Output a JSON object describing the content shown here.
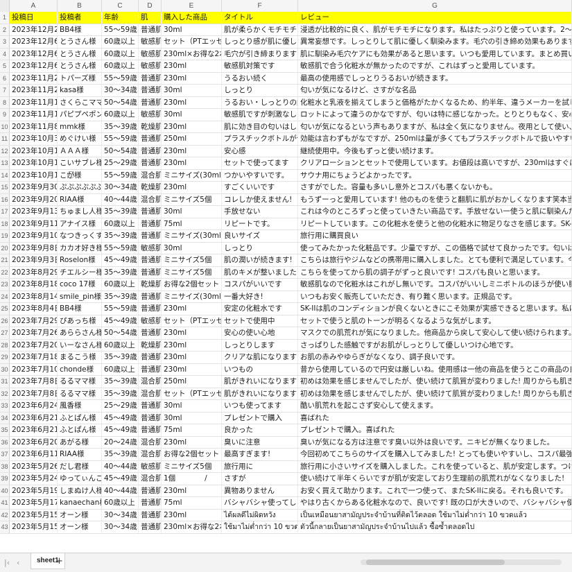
{
  "columns": [
    "A",
    "B",
    "C",
    "D",
    "E",
    "F",
    "G"
  ],
  "header": [
    "投稿日",
    "投稿者",
    "年齢",
    "肌",
    "購入した商品",
    "タイトル",
    "レビュー"
  ],
  "rows": [
    [
      "2023年12月21日",
      "BB4様",
      "55～59歳",
      "普通肌",
      "30ml",
      "肌が柔らかくモチモチになります",
      "浸透が比較的に良く、肌がモチモチになります。私はたっぷりと使っています。2～3回、たっぷりの量を染み込ませると実感"
    ],
    [
      "2023年12月6日",
      "とうさん様",
      "60歳以上",
      "敏感肌",
      "セット（PTエッセンス+クリ",
      "しっとり感が肌に優しいです",
      "異常妄想です。しっとりして肌に優しく馴染みます。毛穴の引き締め効果もあります。"
    ],
    [
      "2023年12月6日",
      "とうさん様",
      "60歳以上",
      "敏感肌",
      "230ml×お得な2本セット",
      "毛穴が引き締まります",
      "肌に馴染み毛穴ケアにも効果があると思います。いつも愛用しています。まとめ買いが嬉しいです。"
    ],
    [
      "2023年12月6日",
      "とうさん様",
      "60歳以上",
      "敏感肌",
      "230ml",
      "敏感肌対策です",
      "敏感肌で合う化粧水が無かったのですが、これはずっと愛用しています。"
    ],
    [
      "2023年11月23日",
      "トパーズ様",
      "55～59歳",
      "普通肌",
      "230ml",
      "うるおい続く",
      "最高の使用感でしっとりうるおいが続きます。"
    ],
    [
      "2023年11月20日",
      "kasa様",
      "30～34歳",
      "普通肌",
      "30ml",
      "しっとり",
      "匂いが気になるけど、さすがな名品"
    ],
    [
      "2023年11月13日",
      "さくらこママ様",
      "50～54歳",
      "普通肌",
      "230ml",
      "うるおい・しっとりの継続",
      "化粧水と乳液を揃えてしまうと価格がたかくなるため、約半年、違うメーカーを試してみましたが、この商品に勝るものはありま"
    ],
    [
      "2023年11月12日",
      "パピプペポン様",
      "60歳以上",
      "敏感肌",
      "30ml",
      "敏感肌ですが刺激なし",
      "ロットによって違うのかなですが、匂いは特に感じなかった。とりとりもなく、安心して使えました。トロミのない化粧水が好"
    ],
    [
      "2023年11月8日",
      "mmk様",
      "35～39歳",
      "乾燥肌",
      "230ml",
      "肌に効き目の匂いはしないのでは?",
      "匂いが気になるという声もありますが、私は全く気になりません。夜用として使い、面倒な時は手でバシャバシャとつけるほど"
    ],
    [
      "2023年10月31日",
      "めぐけい様",
      "55～59歳",
      "普通肌",
      "250ml",
      "プラスチックボトルが使いやすい",
      "効能は言わずもがなですが、250mlは量が多くてもプラスチックボトルで扱いやすいので好きです。"
    ],
    [
      "2023年10月19日",
      "ＡＡＡ様",
      "50～54歳",
      "普通肌",
      "230ml",
      "安心感",
      "継続使用中。今後もずっと使い続けます。"
    ],
    [
      "2023年10月16日",
      "こいサブレ様",
      "25～29歳",
      "普通肌",
      "230ml",
      "セットで使ってます",
      "クリアローションとセットで使用しています。お値段は高いですが、230mlはすぐに無くならないので、結構長く使え、普段"
    ],
    [
      "2023年10月11日",
      "こが⃝様",
      "55～59歳",
      "混合肌",
      "ミニサイズ(30ml)3個セット",
      "つかいやすいです。",
      "サウナ用にちょうどよかったです。"
    ],
    [
      "2023年9月30日",
      "ぷぷぷぷぷぷ様",
      "30～34歳",
      "乾燥肌",
      "230ml",
      "すごくいいです",
      "さすがでした。容量も多いし意外とコスパも悪くないかも。"
    ],
    [
      "2023年9月20日",
      "RIAA様",
      "40～44歳",
      "混合肌",
      "ミニサイズ5個",
      "コレしか使えません!",
      "もうずーっと愛用しています! 他のものを使うと翻肌に肌がおかしくなります笑本当に手放せません!"
    ],
    [
      "2023年9月13日",
      "ちゅまし人様",
      "35～39歳",
      "普通肌",
      "30ml",
      "手放せない",
      "これは今のところずっと使っていきたい商品です。手放せない一使うと肌に馴染んだその瞬間からフラットになるというか、"
    ],
    [
      "2023年9月11日",
      "アナイス様",
      "60歳以上",
      "普通肌",
      "75ml",
      "リピートです。",
      "リピートしています。この化粧水を使うと他の化粧水に物足りなさを感じます。SK-IIの化粧水は別格です。"
    ],
    [
      "2023年9月10日",
      "なつきっくす様",
      "35～39歳",
      "普通肌",
      "ミニサイズ(30ml)3個セット",
      "良いサイズ",
      "旅行用に購買良い"
    ],
    [
      "2023年9月8日",
      "カカオ好き様",
      "55～59歳",
      "敏感肌",
      "30ml",
      "しっとり",
      "使ってみたかった化粧品です。少量ですが、この価格で試せて良かったです。匂いは苦手ですが、しっとり、ふっくらし、つ"
    ],
    [
      "2023年9月3日",
      "Roselon様",
      "45～49歳",
      "普通肌",
      "ミニサイズ5個",
      "肌の潤いが続きます!",
      "こちらは旅行やジムなどの携帯用に購入しました。とても便利で満足しています。今使っているものがなくなったら、また購入"
    ],
    [
      "2023年8月29日",
      "チエルシー様",
      "35～39歳",
      "普通肌",
      "ミニサイズ5個",
      "肌のキメが整いました!",
      "こちらを使ってから肌の調子がずっと良いです! コスパも良いと思います。"
    ],
    [
      "2023年8月18日",
      "coco 17様",
      "60歳以上",
      "乾燥肌",
      "お得な2個セット",
      "コスパがいいです",
      "敏感肌なので化粧水はこれがし無いです。コスパがいいしミニボトルのほうが使い勝手がいいので最近はこちらでずっと買"
    ],
    [
      "2023年8月14日",
      "smile_pin様",
      "35～39歳",
      "普通肌",
      "ミニサイズ(30ml)3個セット",
      "一番大好き!",
      "いつもお安く販売していただき、有り難く思います。正規品です。"
    ],
    [
      "2023年8月4日",
      "BB4様",
      "55～59歳",
      "普通肌",
      "230ml",
      "安定の化粧水です",
      "SK-IIは肌のコンディションが良くないときにこそ効果が実感できると思います。私は化粧水だけSK-IIですが、お肌がモチモ"
    ],
    [
      "2023年7月29日",
      "ぴあっち様",
      "45～49歳",
      "敏感肌",
      "セット（PTエッセンス+クリ",
      "セットで使用中",
      "セットで使うと肌のトーンが明るくなるような気がします。"
    ],
    [
      "2023年7月26日",
      "あららさん様",
      "50～54歳",
      "普通肌",
      "230ml",
      "安心の使い心地",
      "マスクでの肌荒れが気になりました。他商品から戻して安心して使い続けられます。"
    ],
    [
      "2023年7月20日",
      "いーなさん様",
      "60歳以上",
      "乾燥肌",
      "230ml",
      "しっとりします",
      "さっぱりした感触ですがお肌がしっとりして優しいつけ心地です。"
    ],
    [
      "2023年7月18日",
      "まるこう様",
      "35～39歳",
      "普通肌",
      "230ml",
      "クリアな肌になります",
      "お肌の赤みやゆらぎがなくなり、調子良いです。"
    ],
    [
      "2023年7月10日",
      "chonde様",
      "60歳以上",
      "普通肌",
      "230ml",
      "いつもの",
      "昔から使用しているので円安は厳しいね。使用感は一他の商品を使うとこの商品の良さがわかるんだよねっ。"
    ],
    [
      "2023年7月8日",
      "るるママ様",
      "35～39歳",
      "混合肌",
      "250ml",
      "肌がきれいになります",
      "初めは効果を感じませんでしたが、使い続けて肌質が変わりました! 周りからも肌きれいになったねと言われます!"
    ],
    [
      "2023年7月8日",
      "るるママ様",
      "35～39歳",
      "混合肌",
      "セット（PTエッセンス+クリ",
      "肌がきれいになります",
      "初めは効果を感じませんでしたが、使い続けて肌質が変わりました! 周りからも肌きれいになったねと言われます!"
    ],
    [
      "2023年6月24日",
      "風香様",
      "25～29歳",
      "普通肌",
      "30ml",
      "いつも使ってます",
      "酷い肌荒れを起こさず安心して使えます。"
    ],
    [
      "2023年6月21日",
      "ふとぱん様",
      "45～49歳",
      "普通肌",
      "30ml",
      "プレゼントで購入",
      "喜ばれた"
    ],
    [
      "2023年6月21日",
      "ふとぱん様",
      "45～49歳",
      "普通肌",
      "75ml",
      "良かった",
      "プレゼントで購入。喜ばれた"
    ],
    [
      "2023年6月20日",
      "あがる様",
      "20～24歳",
      "混合肌",
      "230ml",
      "臭いに注意",
      "臭いが気になる方は注意です臭い以外は良いです。ニキビが無くなりました。"
    ],
    [
      "2023年6月11日",
      "RIAA様",
      "35～39歳",
      "混合肌",
      "お得な2個セット",
      "最高すぎます!",
      "今回初めてこちらのサイズを購入してみました! とっても使いやすいし、コスパ最強です!! 温泉に持って行くのに最適で"
    ],
    [
      "2023年5月26日",
      "だし君様",
      "40～44歳",
      "敏感肌",
      "ミニサイズ5個",
      "旅行用に",
      "旅行用に小さいサイズを購入しました。これを使っていると、肌が安定します。つけたときは保湿力が足りない気がしますが"
    ],
    [
      "2023年5月24日",
      "ゆってぃんこ様",
      "45～49歳",
      "混合肌",
      "1個　　　　/",
      "さすが",
      "使い続けて半年くらいですが肌が安定しており生理前の肌荒れがなくなりました!"
    ],
    [
      "2023年5月19日",
      "しまぬけ人様",
      "40～44歳",
      "普通肌",
      "230ml",
      "異物ありません",
      "お安く買えて助かります。これで一つ使って、またSK-IIに戻る。それも良いです。"
    ],
    [
      "2023年5月17日",
      "kanaechan様",
      "60歳以上",
      "普通肌",
      "75ml",
      "バシャバシャ使ってしまいました",
      "やはり古くからある化粧水なので、良いです! 既の口が大きいので、バシャバシャ使っているとあっという間に無くなりま"
    ],
    [
      "2023年5月15日",
      "オーン様",
      "30～34歳",
      "普通肌",
      "230ml",
      "ได้ผลดีไม่ผิดหวัง",
      "เป็นเหมือนยาสามัญประจำบ้านที่ติดไว้ตลอด ใช้มาไม่ต่ำกว่า 10 ขวดแล้ว"
    ],
    [
      "2023年5月15日",
      "オーン様",
      "30～34歳",
      "普通肌",
      "230ml×お得な2本セット",
      "ใช้มาไม่ต่ำกว่า 10 ขวด",
      "ตัวนี้กลายเป็นยาสามัญประจำบ้านไปแล้ว ซื้อซ้ำตลอดไป"
    ]
  ],
  "sheet_tab": "sheet1",
  "add_tab_label": "+",
  "colors": {
    "header_fill": "#ffff00"
  }
}
